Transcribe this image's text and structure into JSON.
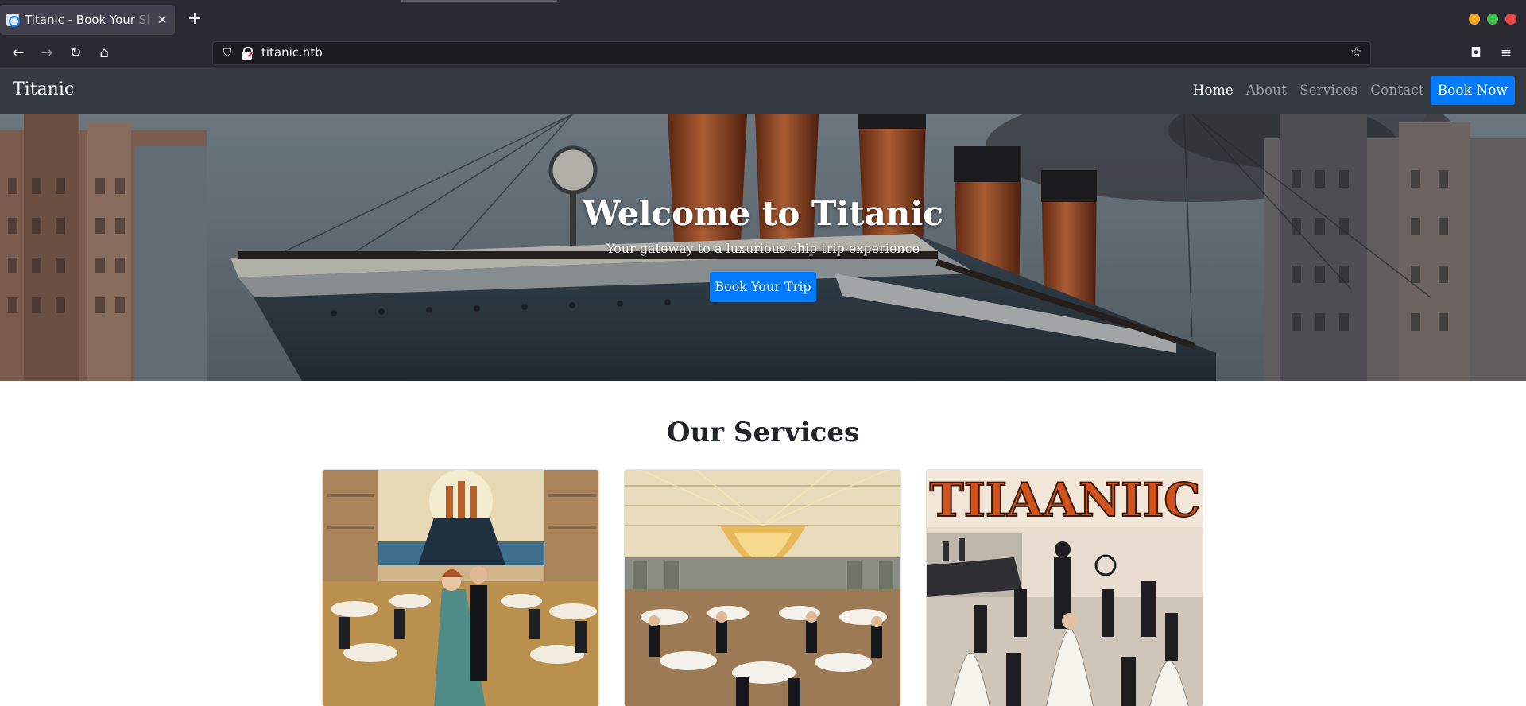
{
  "browser": {
    "tab_title": "Titanic - Book Your Ship Trip",
    "tab_close": "✕",
    "new_tab": "+",
    "url": "titanic.htb",
    "icons": [
      "back-icon",
      "forward-icon",
      "reload-icon",
      "home-icon",
      "shield-icon",
      "lock-icon",
      "star-icon",
      "pocket-icon",
      "menu-icon"
    ],
    "window_controls_colors": [
      "#f5a623",
      "#3fc24d",
      "#f04848"
    ]
  },
  "site": {
    "brand": "Titanic",
    "nav": {
      "home": "Home",
      "about": "About",
      "services": "Services",
      "contact": "Contact",
      "book_now": "Book Now"
    },
    "hero": {
      "title": "Welcome to Titanic",
      "subtitle": "Your gateway to a luxurious ship trip experience",
      "button": "Book Your Trip"
    },
    "services": {
      "title": "Our Services",
      "card_count_visible": 3,
      "card_images": [
        "ballroom-dance-image",
        "dining-hall-image",
        "entertainment-poster-image"
      ],
      "poster_text": "TIIAANIIC"
    }
  },
  "colors": {
    "primary": "#007bff",
    "navbar": "#343a40",
    "browser_chrome": "#2b2a33"
  }
}
